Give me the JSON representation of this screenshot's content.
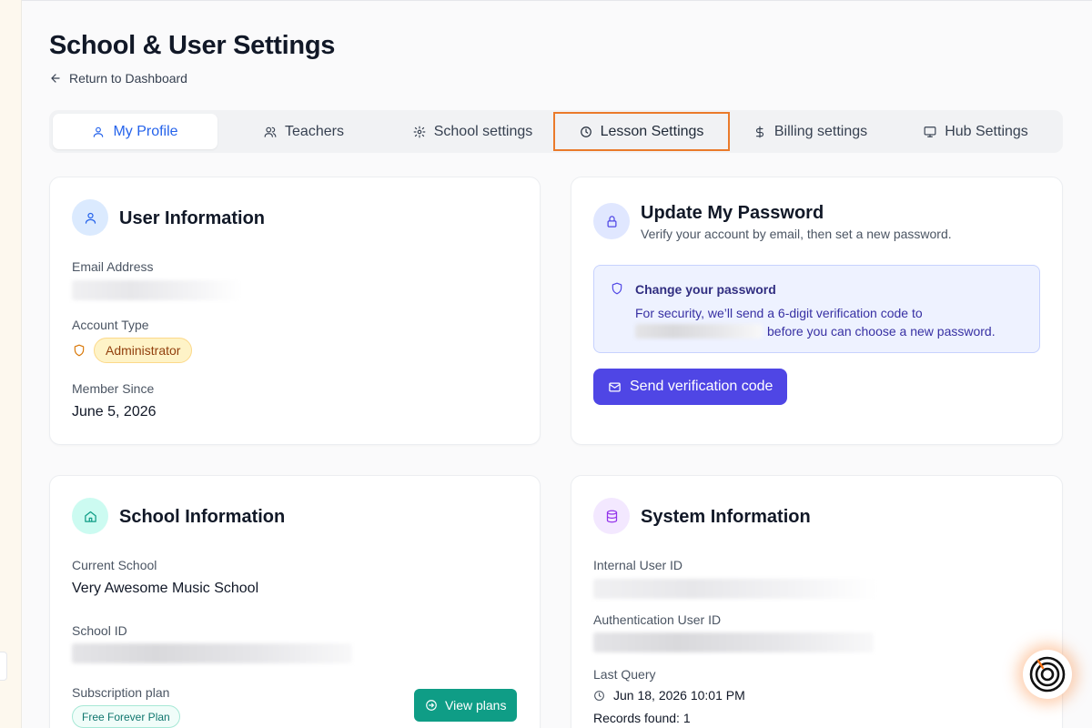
{
  "page": {
    "title": "School & User Settings",
    "back_label": "Return to Dashboard"
  },
  "tabs": [
    {
      "label": "My Profile",
      "icon": "user-icon",
      "active": true
    },
    {
      "label": "Teachers",
      "icon": "users-icon"
    },
    {
      "label": "School settings",
      "icon": "gear-icon"
    },
    {
      "label": "Lesson Settings",
      "icon": "clock-icon",
      "highlighted": true
    },
    {
      "label": "Billing settings",
      "icon": "dollar-icon"
    },
    {
      "label": "Hub Settings",
      "icon": "monitor-icon"
    }
  ],
  "user_info": {
    "title": "User Information",
    "email_label": "Email Address",
    "account_type_label": "Account Type",
    "account_type": "Administrator",
    "member_since_label": "Member Since",
    "member_since": "June 5, 2026"
  },
  "password": {
    "title": "Update My Password",
    "subtitle": "Verify your account by email, then set a new password.",
    "notice_title": "Change your password",
    "notice_line1": "For security, we’ll send a 6-digit verification code to",
    "notice_line2": "before you can choose a new password.",
    "button_label": "Send verification code"
  },
  "school_info": {
    "title": "School Information",
    "current_school_label": "Current School",
    "current_school": "Very Awesome Music School",
    "school_id_label": "School ID",
    "subscription_label": "Subscription plan",
    "plan": "Free Forever Plan",
    "view_plans_label": "View plans"
  },
  "system_info": {
    "title": "System Information",
    "internal_id_label": "Internal User ID",
    "auth_id_label": "Authentication User ID",
    "last_query_label": "Last Query",
    "last_query": "Jun 18, 2026 10:01 PM",
    "records_found": "Records found: 1"
  },
  "colors": {
    "accent_blue": "#2563eb",
    "primary_indigo": "#4f46e5",
    "teal": "#0f9d86",
    "highlight_orange": "#ea7a2a",
    "admin_badge_bg": "#fef3c7"
  }
}
